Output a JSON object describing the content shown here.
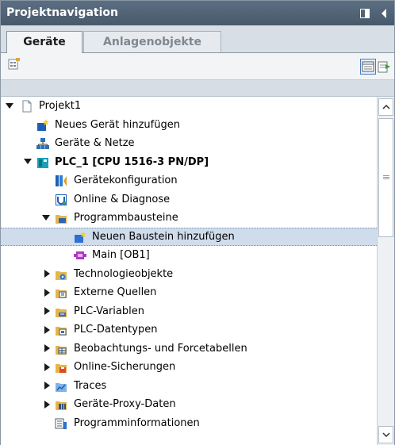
{
  "panel": {
    "title": "Projektnavigation"
  },
  "tabs": [
    {
      "label": "Geräte",
      "active": true
    },
    {
      "label": "Anlagenobjekte",
      "active": false
    }
  ],
  "tree": [
    {
      "label": "Projekt1",
      "level": 0,
      "arrow": "expanded",
      "icon": "project-icon",
      "bold": false
    },
    {
      "label": "Neues Gerät hinzufügen",
      "level": 1,
      "arrow": "none",
      "icon": "add-device-icon",
      "bold": false
    },
    {
      "label": "Geräte & Netze",
      "level": 1,
      "arrow": "none",
      "icon": "devices-networks-icon",
      "bold": false
    },
    {
      "label": "PLC_1 [CPU 1516-3 PN/DP]",
      "level": 1,
      "arrow": "expanded",
      "icon": "plc-icon",
      "bold": true
    },
    {
      "label": "Gerätekonfiguration",
      "level": 2,
      "arrow": "none",
      "icon": "device-config-icon",
      "bold": false
    },
    {
      "label": "Online & Diagnose",
      "level": 2,
      "arrow": "none",
      "icon": "online-diagnose-icon",
      "bold": false
    },
    {
      "label": "Programmbausteine",
      "level": 2,
      "arrow": "expanded",
      "icon": "program-blocks-folder-icon",
      "bold": false
    },
    {
      "label": "Neuen Baustein hinzufügen",
      "level": 3,
      "arrow": "none",
      "icon": "add-block-icon",
      "bold": false,
      "selected": true
    },
    {
      "label": "Main [OB1]",
      "level": 3,
      "arrow": "none",
      "icon": "ob-block-icon",
      "bold": false
    },
    {
      "label": "Technologieobjekte",
      "level": 2,
      "arrow": "collapsed",
      "icon": "technology-objects-folder-icon",
      "bold": false
    },
    {
      "label": "Externe Quellen",
      "level": 2,
      "arrow": "collapsed",
      "icon": "external-sources-folder-icon",
      "bold": false
    },
    {
      "label": "PLC-Variablen",
      "level": 2,
      "arrow": "collapsed",
      "icon": "plc-tags-folder-icon",
      "bold": false
    },
    {
      "label": "PLC-Datentypen",
      "level": 2,
      "arrow": "collapsed",
      "icon": "plc-datatypes-folder-icon",
      "bold": false
    },
    {
      "label": "Beobachtungs- und Forcetabellen",
      "level": 2,
      "arrow": "collapsed",
      "icon": "watch-force-tables-folder-icon",
      "bold": false
    },
    {
      "label": "Online-Sicherungen",
      "level": 2,
      "arrow": "collapsed",
      "icon": "online-backups-folder-icon",
      "bold": false
    },
    {
      "label": "Traces",
      "level": 2,
      "arrow": "collapsed",
      "icon": "traces-folder-icon",
      "bold": false
    },
    {
      "label": "Geräte-Proxy-Daten",
      "level": 2,
      "arrow": "collapsed",
      "icon": "device-proxy-data-folder-icon",
      "bold": false
    },
    {
      "label": "Programminformationen",
      "level": 2,
      "arrow": "none",
      "icon": "program-info-icon",
      "bold": false
    }
  ]
}
